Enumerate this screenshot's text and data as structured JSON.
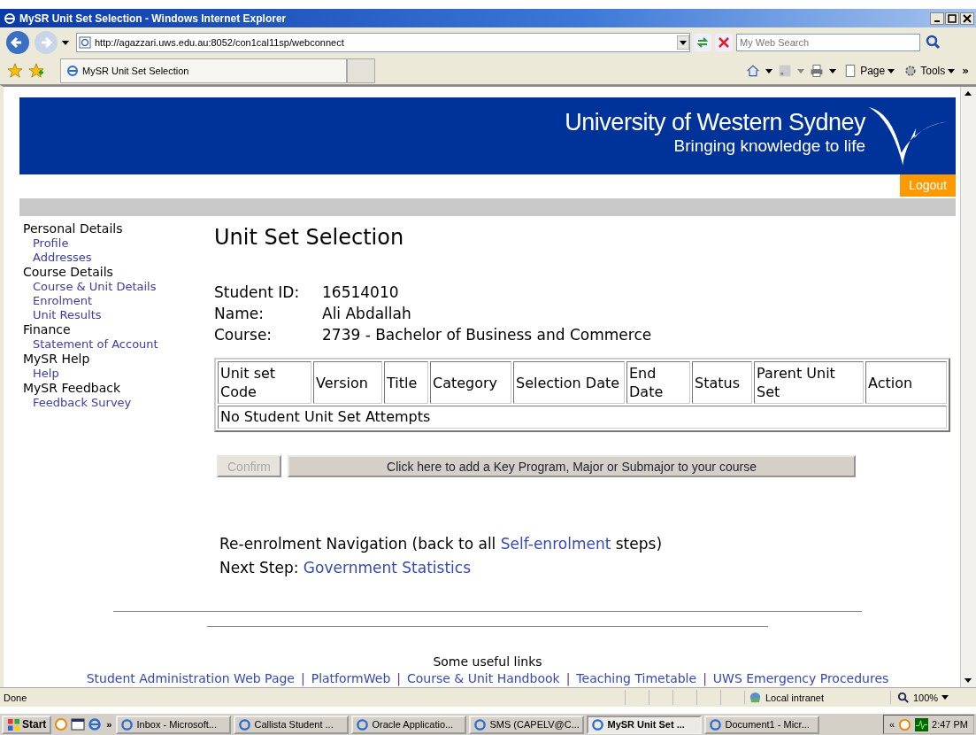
{
  "window": {
    "title": "MySR Unit Set Selection - Windows Internet Explorer"
  },
  "browser": {
    "address": "http://agazzari.uws.edu.au:8052/con1cal11sp/webconnect",
    "search_placeholder": "My Web Search",
    "tab": "MySR Unit Set Selection",
    "tools": [
      {
        "label": "Page"
      },
      {
        "label": "Tools"
      }
    ],
    "overflow": "»"
  },
  "banner": {
    "title": "University of Western Sydney",
    "tagline": "Bringing knowledge to life",
    "logout": "Logout"
  },
  "sidebar": [
    {
      "label": "Personal Details",
      "children": [
        {
          "label": "Profile"
        },
        {
          "label": "Addresses"
        }
      ]
    },
    {
      "label": "Course Details",
      "children": [
        {
          "label": "Course & Unit Details"
        },
        {
          "label": "Enrolment"
        },
        {
          "label": "Unit Results"
        }
      ]
    },
    {
      "label": "Finance",
      "children": [
        {
          "label": "Statement of Account"
        }
      ]
    },
    {
      "label": "MySR Help",
      "children": [
        {
          "label": "Help"
        }
      ]
    },
    {
      "label": "MySR Feedback",
      "children": [
        {
          "label": "Feedback Survey"
        }
      ]
    }
  ],
  "heading": "Unit Set Selection",
  "student": [
    {
      "label": "Student ID:",
      "value": "16514010"
    },
    {
      "label": "Name:",
      "value": "Ali Abdallah"
    },
    {
      "label": "Course:",
      "value": "2739 - Bachelor of Business and Commerce"
    }
  ],
  "table": {
    "columns": [
      "Unit set Code",
      "Version",
      "Title",
      "Category",
      "Selection Date",
      "End Date",
      "Status",
      "Parent Unit Set",
      "Action"
    ],
    "empty_message": "No Student Unit Set Attempts"
  },
  "buttons": [
    {
      "label": "Confirm",
      "disabled": true
    },
    {
      "label": "Click here to add a Key Program, Major or Submajor to your course",
      "disabled": false
    }
  ],
  "navigation": {
    "before": "Re-enrolment Navigation (back to all ",
    "link": "Self-enrolment",
    "after": " steps)",
    "next_label": "Next Step:",
    "next_link": "Government Statistics"
  },
  "footer": {
    "title": "Some useful links",
    "links": [
      "Student Administration Web Page",
      "PlatformWeb",
      "Course & Unit Handbook",
      "Teaching Timetable",
      "UWS Emergency Procedures"
    ],
    "separator": "|"
  },
  "status_bar": {
    "text": "Done",
    "zone": "Local intranet",
    "zoom": "100%"
  },
  "taskbar": {
    "start": "Start",
    "overflow": "»",
    "items": [
      {
        "label": "Inbox - Microsoft...",
        "selected": false
      },
      {
        "label": "Callista Student ...",
        "selected": false
      },
      {
        "label": "Oracle Applicatio...",
        "selected": false
      },
      {
        "label": "SMS (CAPELV@C...",
        "selected": false
      },
      {
        "label": "MySR Unit Set ...",
        "selected": true
      },
      {
        "label": "Document1 - Micr...",
        "selected": false
      }
    ],
    "tray_overflow": "«",
    "time": "2:47 PM"
  }
}
